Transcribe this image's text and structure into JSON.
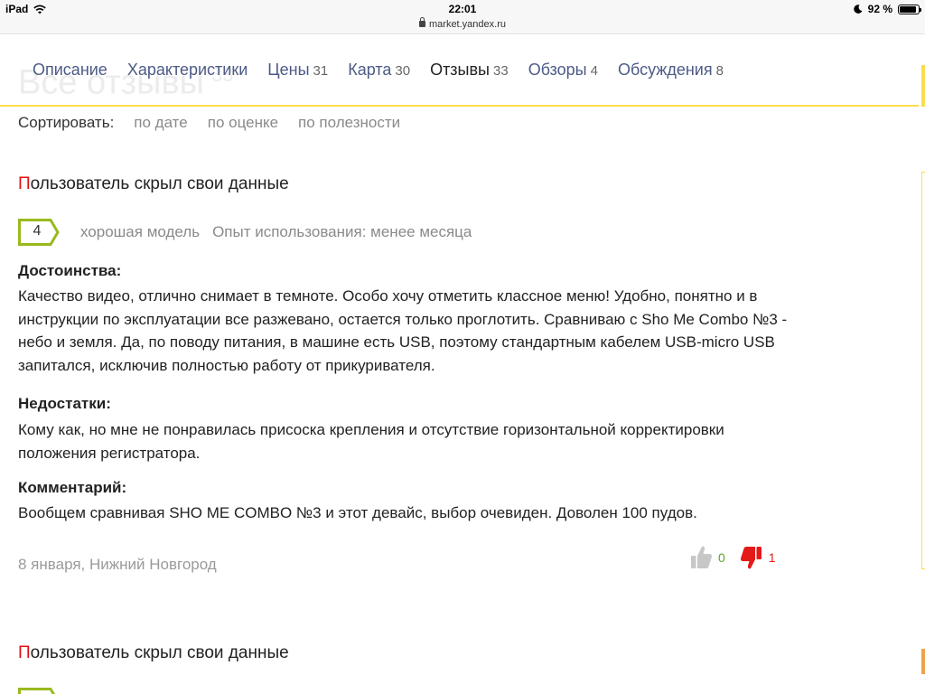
{
  "status_bar": {
    "device": "iPad",
    "time": "22:01",
    "url": "market.yandex.ru",
    "battery": "92 %",
    "battery_level": 0.92
  },
  "page": {
    "ghost_title": "Все отзывы",
    "ghost_count": "33"
  },
  "tabs": [
    {
      "label": "Описание",
      "count": ""
    },
    {
      "label": "Характеристики",
      "count": ""
    },
    {
      "label": "Цены",
      "count": "31"
    },
    {
      "label": "Карта",
      "count": "30"
    },
    {
      "label": "Отзывы",
      "count": "33"
    },
    {
      "label": "Обзоры",
      "count": "4"
    },
    {
      "label": "Обсуждения",
      "count": "8"
    }
  ],
  "active_tab": "Отзывы",
  "sort": {
    "label": "Сортировать:",
    "options": [
      "по дате",
      "по оценке",
      "по полезности"
    ]
  },
  "reviews": [
    {
      "author_first": "П",
      "author_rest": "ользователь скрыл свои данные",
      "rating": "4",
      "rating_text": "хорошая модель",
      "experience": "Опыт использования: менее месяца",
      "pros_title": "Достоинства:",
      "pros": "Качество видео, отлично снимает в темноте. Особо хочу отметить классное меню! Удобно, понятно и в инструкции по эксплуатации все разжевано, остается только проглотить. Сравниваю с Sho Me Combo №3 - небо и земля. Да, по поводу питания, в машине есть USB, поэтому стандартным кабелем USB-micro USB запитался, исключив полностью работу от прикуривателя.",
      "cons_title": "Недостатки:",
      "cons": "Кому как, но мне не понравилась присоска крепления и отсутствие горизонтальной корректировки положения регистратора.",
      "comment_title": "Комментарий:",
      "comment": "Вообщем сравнивая SHO ME COMBO №3 и этот девайс, выбор очевиден. Доволен 100 пудов.",
      "date_place": "8 января, Нижний Новгород",
      "likes": "0",
      "dislikes": "1"
    },
    {
      "author_first": "П",
      "author_rest": "ользователь скрыл свои данные"
    }
  ],
  "colors": {
    "accent_yellow": "#fcdc4d",
    "rating_green": "#99b91e",
    "author_red": "#e01010",
    "like_green": "#59a531",
    "dislike_red": "#e41919",
    "tab_blue": "#4c5a86"
  }
}
